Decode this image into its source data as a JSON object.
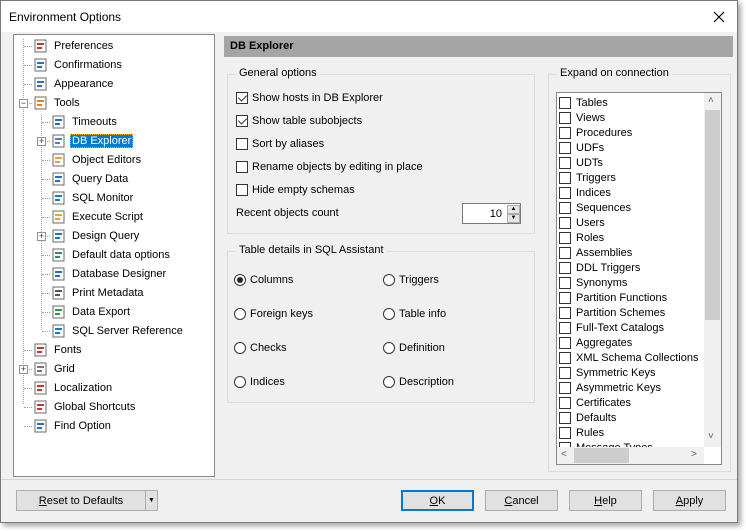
{
  "window": {
    "title": "Environment Options"
  },
  "tree": {
    "items": [
      {
        "label": "Preferences",
        "icon": "preferences-icon"
      },
      {
        "label": "Confirmations",
        "icon": "confirmations-icon"
      },
      {
        "label": "Appearance",
        "icon": "appearance-icon"
      },
      {
        "label": "Tools",
        "icon": "tools-gear-icon",
        "expanded": true
      },
      {
        "label": "Timeouts",
        "icon": "timeouts-icon"
      },
      {
        "label": "DB Explorer",
        "icon": "db-explorer-icon",
        "selected": true,
        "collapsed": true
      },
      {
        "label": "Object Editors",
        "icon": "object-editors-icon"
      },
      {
        "label": "Query Data",
        "icon": "query-data-icon"
      },
      {
        "label": "SQL Monitor",
        "icon": "sql-monitor-icon"
      },
      {
        "label": "Execute Script",
        "icon": "execute-script-icon"
      },
      {
        "label": "Design Query",
        "icon": "design-query-icon",
        "collapsed": true
      },
      {
        "label": "Default data options",
        "icon": "default-data-options-icon"
      },
      {
        "label": "Database Designer",
        "icon": "database-designer-icon"
      },
      {
        "label": "Print Metadata",
        "icon": "printer-icon"
      },
      {
        "label": "Data Export",
        "icon": "data-export-icon"
      },
      {
        "label": "SQL Server Reference",
        "icon": "sql-server-reference-icon"
      },
      {
        "label": "Fonts",
        "icon": "fonts-icon"
      },
      {
        "label": "Grid",
        "icon": "grid-icon",
        "collapsed": true
      },
      {
        "label": "Localization",
        "icon": "localization-icon"
      },
      {
        "label": "Global Shortcuts",
        "icon": "global-shortcuts-icon"
      },
      {
        "label": "Find Option",
        "icon": "find-option-icon"
      }
    ]
  },
  "panel": {
    "header": "DB Explorer",
    "general": {
      "title": "General options",
      "options": [
        {
          "label": "Show hosts in DB Explorer",
          "checked": true
        },
        {
          "label": "Show table subobjects",
          "checked": true
        },
        {
          "label": "Sort by aliases",
          "checked": false
        },
        {
          "label": "Rename objects by editing in place",
          "checked": false
        },
        {
          "label": "Hide empty schemas",
          "checked": false
        }
      ],
      "recent_label": "Recent objects count",
      "recent_value": "10"
    },
    "table_details": {
      "title": "Table details in SQL Assistant",
      "options": [
        {
          "label": "Columns",
          "selected": true
        },
        {
          "label": "Triggers",
          "selected": false
        },
        {
          "label": "Foreign keys",
          "selected": false
        },
        {
          "label": "Table info",
          "selected": false
        },
        {
          "label": "Checks",
          "selected": false
        },
        {
          "label": "Definition",
          "selected": false
        },
        {
          "label": "Indices",
          "selected": false
        },
        {
          "label": "Description",
          "selected": false
        }
      ]
    },
    "expand": {
      "title": "Expand on connection",
      "items": [
        {
          "label": "Tables",
          "checked": false
        },
        {
          "label": "Views",
          "checked": false
        },
        {
          "label": "Procedures",
          "checked": false
        },
        {
          "label": "UDFs",
          "checked": false
        },
        {
          "label": "UDTs",
          "checked": false
        },
        {
          "label": "Triggers",
          "checked": false
        },
        {
          "label": "Indices",
          "checked": false
        },
        {
          "label": "Sequences",
          "checked": false
        },
        {
          "label": "Users",
          "checked": false
        },
        {
          "label": "Roles",
          "checked": false
        },
        {
          "label": "Assemblies",
          "checked": false
        },
        {
          "label": "DDL Triggers",
          "checked": false
        },
        {
          "label": "Synonyms",
          "checked": false
        },
        {
          "label": "Partition Functions",
          "checked": false
        },
        {
          "label": "Partition Schemes",
          "checked": false
        },
        {
          "label": "Full-Text Catalogs",
          "checked": false
        },
        {
          "label": "Aggregates",
          "checked": false
        },
        {
          "label": "XML Schema Collections",
          "checked": false
        },
        {
          "label": "Symmetric Keys",
          "checked": false
        },
        {
          "label": "Asymmetric Keys",
          "checked": false
        },
        {
          "label": "Certificates",
          "checked": false
        },
        {
          "label": "Defaults",
          "checked": false
        },
        {
          "label": "Rules",
          "checked": false
        },
        {
          "label": "Message Types",
          "checked": false
        }
      ]
    }
  },
  "buttons": {
    "reset": {
      "mnemonic": "R",
      "rest": "eset to Defaults"
    },
    "ok": {
      "mnemonic": "O",
      "rest": "K"
    },
    "cancel": {
      "mnemonic": "C",
      "rest": "ancel"
    },
    "help": {
      "mnemonic": "H",
      "rest": "elp"
    },
    "apply": {
      "mnemonic": "A",
      "rest": "pply"
    }
  },
  "colors": {
    "selection": "#0078d7",
    "header_bg": "#a5a5a5"
  }
}
